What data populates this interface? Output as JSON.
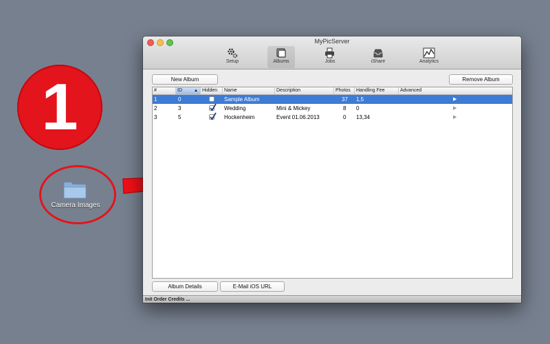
{
  "step": {
    "number": "1",
    "color": "#e3141b"
  },
  "desktop": {
    "folder_label": "Camera Images",
    "folder_icon": "folder-icon"
  },
  "window": {
    "title": "MyPicServer",
    "toolbar": [
      {
        "label": "Setup",
        "icon": "gear-icon"
      },
      {
        "label": "Albums",
        "icon": "albums-icon",
        "active": true
      },
      {
        "label": "Jobs",
        "icon": "printer-icon"
      },
      {
        "label": "iShare",
        "icon": "inbox-icon"
      },
      {
        "label": "Analytics",
        "icon": "chart-icon"
      }
    ],
    "buttons": {
      "new_album": "New Album",
      "remove_album": "Remove Album",
      "album_details": "Album Details",
      "email_ios_url": "E-Mail iOS URL"
    },
    "table": {
      "columns": [
        "#",
        "ID",
        "Hidden",
        "Name",
        "Description",
        "Photos",
        "Handling Fee",
        "Advanced"
      ],
      "sorted_column": "ID",
      "rows": [
        {
          "num": "1",
          "id": "0",
          "hidden": false,
          "name": "Sample Album",
          "description": "",
          "photos": "37",
          "fee": "1,5",
          "selected": true
        },
        {
          "num": "2",
          "id": "3",
          "hidden": true,
          "name": "Wedding",
          "description": "Mini & Mickey",
          "photos": "8",
          "fee": "0",
          "selected": false
        },
        {
          "num": "3",
          "id": "5",
          "hidden": true,
          "name": "Hockenheim",
          "description": "Event 01.06.2013",
          "photos": "0",
          "fee": "13,34",
          "selected": false
        }
      ]
    },
    "status": "Init Order Credits ..."
  },
  "colors": {
    "selection": "#3d7bd4",
    "background": "#77808f"
  }
}
